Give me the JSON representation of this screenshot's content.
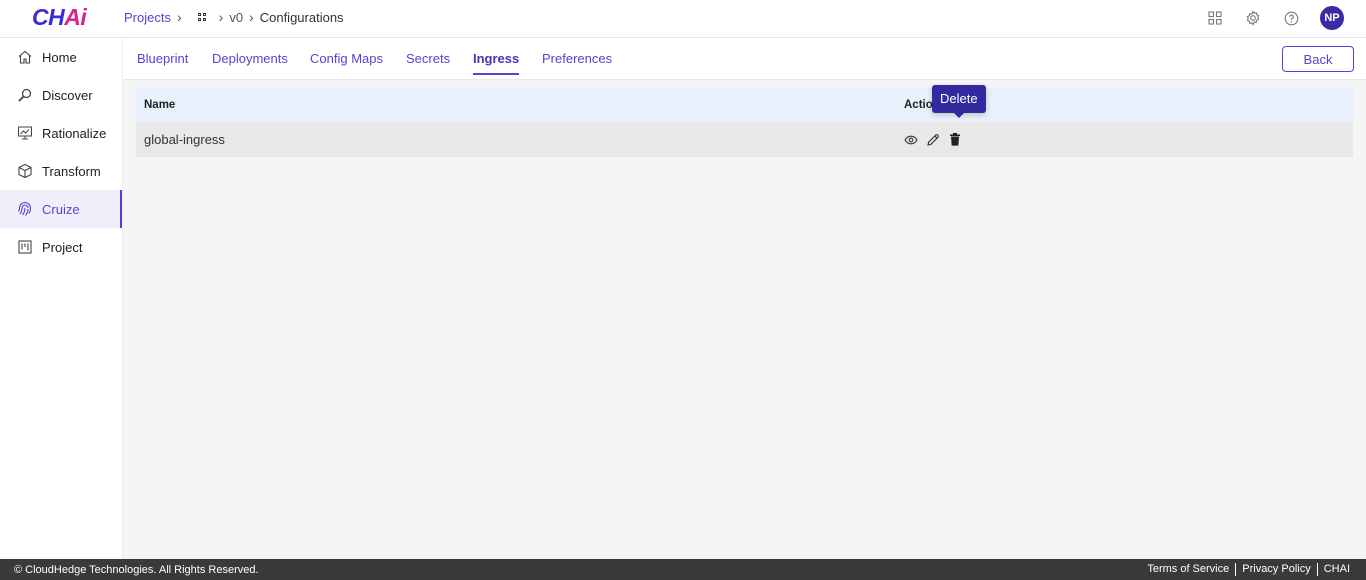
{
  "header": {
    "logo_main": "CH",
    "logo_accent": "Ai",
    "breadcrumb": {
      "projects": "Projects",
      "version": "v0",
      "current": "Configurations"
    },
    "avatar_initials": "NP"
  },
  "sidebar": {
    "items": [
      {
        "label": "Home",
        "icon": "home-icon"
      },
      {
        "label": "Discover",
        "icon": "search-icon"
      },
      {
        "label": "Rationalize",
        "icon": "chart-board-icon"
      },
      {
        "label": "Transform",
        "icon": "cube-icon"
      },
      {
        "label": "Cruize",
        "icon": "fingerprint-icon",
        "active": true
      },
      {
        "label": "Project",
        "icon": "kanban-icon"
      }
    ]
  },
  "tabs": [
    {
      "label": "Blueprint"
    },
    {
      "label": "Deployments"
    },
    {
      "label": "Config Maps"
    },
    {
      "label": "Secrets"
    },
    {
      "label": "Ingress",
      "active": true
    },
    {
      "label": "Preferences"
    }
  ],
  "back_label": "Back",
  "table": {
    "columns": [
      "Name",
      "Actio"
    ],
    "rows": [
      {
        "name": "global-ingress"
      }
    ]
  },
  "tooltip": "Delete",
  "footer": {
    "copyright": "© CloudHedge Technologies. All Rights Reserved.",
    "links": [
      "Terms of Service",
      "Privacy Policy",
      "CHAI"
    ]
  },
  "colors": {
    "accent": "#5b3fd1",
    "avatar": "#3b2ba6",
    "tooltip": "#332aa0",
    "footer": "#3a3a3a"
  }
}
